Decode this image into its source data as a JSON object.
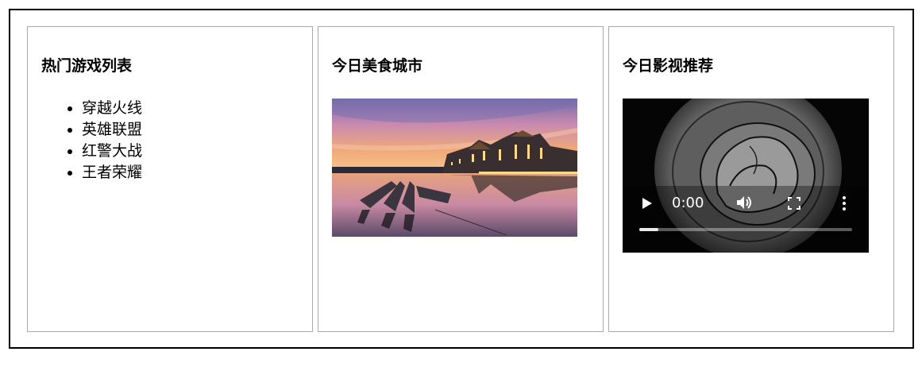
{
  "panels": {
    "games": {
      "title": "热门游戏列表",
      "items": [
        "穿越火线",
        "英雄联盟",
        "红警大战",
        "王者荣耀"
      ]
    },
    "food": {
      "title": "今日美食城市"
    },
    "movie": {
      "title": "今日影视推荐",
      "video": {
        "time": "0:00",
        "progress_fraction": 0.09
      }
    }
  },
  "icons": [
    "play-icon",
    "volume-icon",
    "fullscreen-icon",
    "more-options-icon"
  ]
}
